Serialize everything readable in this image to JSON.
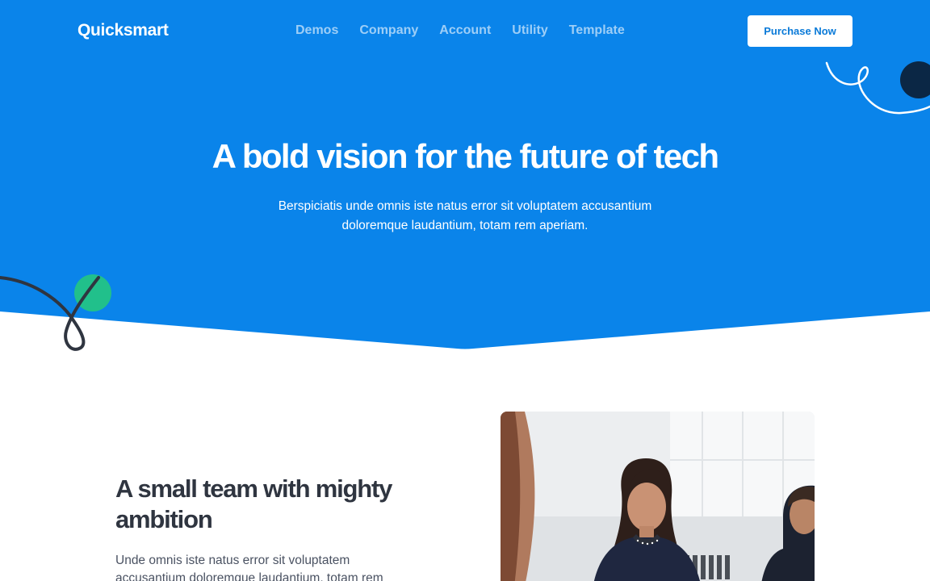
{
  "brand": {
    "name": "Quicksmart"
  },
  "nav": {
    "links": [
      {
        "label": "Demos"
      },
      {
        "label": "Company"
      },
      {
        "label": "Account"
      },
      {
        "label": "Utility"
      },
      {
        "label": "Template"
      }
    ],
    "cta_label": "Purchase Now"
  },
  "hero": {
    "title": "A bold vision for the future of tech",
    "subtitle": "Berspiciatis unde omnis iste natus error sit voluptatem accusantium doloremque laudantium, totam rem aperiam."
  },
  "about": {
    "title": "A small team with mighty ambition",
    "body": "Unde omnis iste natus error sit voluptatem accusantium doloremque laudantium, totam rem aperiam."
  },
  "colors": {
    "hero_bg": "#0a84ea",
    "cta_text": "#0a7ad8",
    "heading_dark": "#2f3540",
    "accent_green": "#21c08b",
    "accent_navy": "#0b2745"
  },
  "icons": {
    "deco_top_right": "squiggle-circle-decoration",
    "deco_left": "loop-circle-decoration"
  },
  "image": {
    "subject": "team-photo"
  }
}
